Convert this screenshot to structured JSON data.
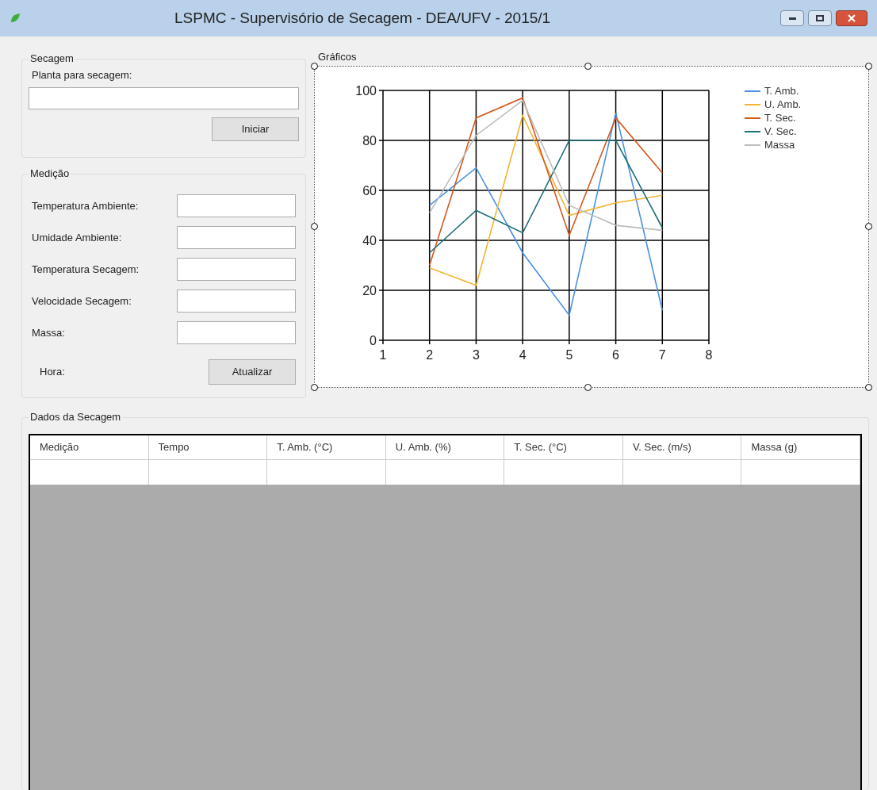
{
  "window": {
    "title": "LSPMC - Supervisório de Secagem -  DEA/UFV - 2015/1"
  },
  "secagem": {
    "title": "Secagem",
    "label": "Planta para secagem:",
    "button": "Iniciar"
  },
  "medicao": {
    "title": "Medição",
    "fields": [
      {
        "label": "Temperatura Ambiente:"
      },
      {
        "label": "Umidade Ambiente:"
      },
      {
        "label": "Temperatura Secagem:"
      },
      {
        "label": "Velocidade Secagem:"
      },
      {
        "label": "Massa:"
      }
    ],
    "hora_label": "Hora:",
    "button": "Atualizar"
  },
  "graficos": {
    "title": "Gráficos",
    "chart_data": {
      "type": "line",
      "grid": true,
      "legend": true,
      "x": [
        2,
        3,
        4,
        5,
        6,
        7
      ],
      "xlim": [
        1,
        8
      ],
      "ylim": [
        0,
        100
      ],
      "xticks": [
        1,
        2,
        3,
        4,
        5,
        6,
        7,
        8
      ],
      "yticks": [
        0,
        20,
        40,
        60,
        80,
        100
      ],
      "series": [
        {
          "name": "T. Amb.",
          "color": "#4a90e2",
          "values": [
            54,
            69,
            35,
            10,
            91,
            12
          ]
        },
        {
          "name": "U. Amb.",
          "color": "#f2b431",
          "values": [
            29,
            22,
            90,
            50,
            55,
            58
          ]
        },
        {
          "name": "T. Sec.",
          "color": "#d45a1e",
          "values": [
            30,
            89,
            97,
            42,
            89,
            67
          ]
        },
        {
          "name": "V. Sec.",
          "color": "#1d6f7a",
          "values": [
            35,
            52,
            43,
            80,
            80,
            45
          ]
        },
        {
          "name": "Massa",
          "color": "#bdbdbd",
          "values": [
            51,
            82,
            96,
            54,
            46,
            44
          ]
        }
      ]
    }
  },
  "dados": {
    "title": "Dados da Secagem",
    "table": {
      "columns": [
        "Medição",
        "Tempo",
        "T. Amb. (°C)",
        "U. Amb. (%)",
        "T. Sec. (°C)",
        "V. Sec. (m/s)",
        "Massa (g)"
      ]
    }
  }
}
